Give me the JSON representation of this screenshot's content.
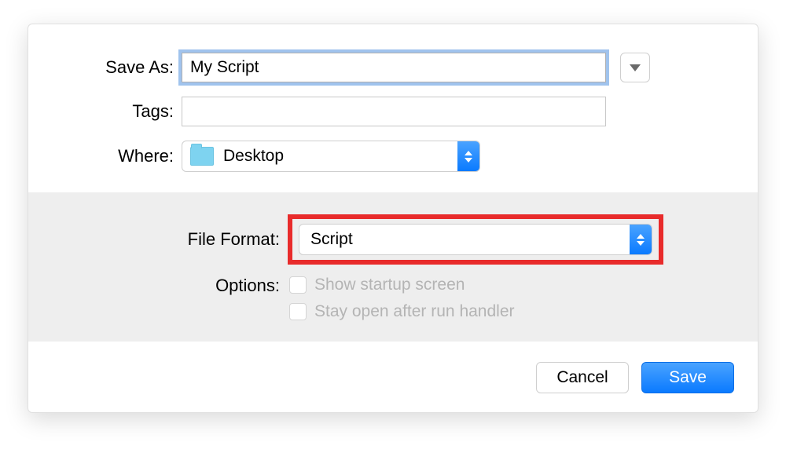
{
  "saveAs": {
    "label": "Save As:",
    "value": "My Script"
  },
  "tags": {
    "label": "Tags:",
    "value": ""
  },
  "where": {
    "label": "Where:",
    "value": "Desktop"
  },
  "fileFormat": {
    "label": "File Format:",
    "value": "Script"
  },
  "options": {
    "label": "Options:",
    "items": [
      {
        "label": "Show startup screen",
        "checked": false,
        "enabled": false
      },
      {
        "label": "Stay open after run handler",
        "checked": false,
        "enabled": false
      }
    ]
  },
  "buttons": {
    "cancel": "Cancel",
    "save": "Save"
  }
}
